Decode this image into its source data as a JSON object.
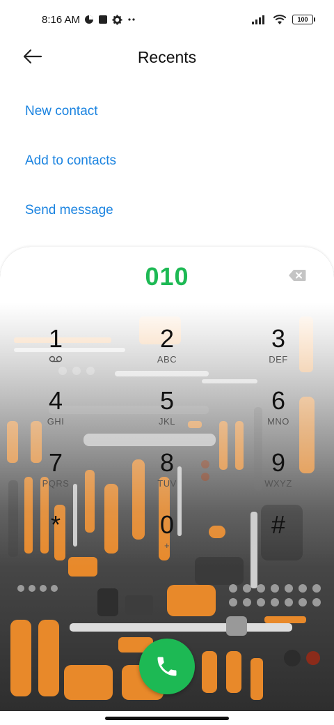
{
  "status_bar": {
    "time": "8:16 AM",
    "battery": "100",
    "icons": [
      "data-saver-icon",
      "square-icon",
      "gear-icon",
      "more-dots-icon",
      "signal-icon",
      "wifi-icon",
      "battery-icon"
    ]
  },
  "header": {
    "title": "Recents",
    "back_icon": "back-arrow-icon"
  },
  "actions": [
    {
      "label": "New contact"
    },
    {
      "label": "Add to contacts"
    },
    {
      "label": "Send message"
    }
  ],
  "dialer": {
    "number": "010",
    "backspace_icon": "backspace-icon",
    "keys": [
      {
        "digit": "1",
        "letters": "voicemail"
      },
      {
        "digit": "2",
        "letters": "ABC"
      },
      {
        "digit": "3",
        "letters": "DEF"
      },
      {
        "digit": "4",
        "letters": "GHI"
      },
      {
        "digit": "5",
        "letters": "JKL"
      },
      {
        "digit": "6",
        "letters": "MNO"
      },
      {
        "digit": "7",
        "letters": "PQRS"
      },
      {
        "digit": "8",
        "letters": "TUV"
      },
      {
        "digit": "9",
        "letters": "WXYZ"
      },
      {
        "digit": "*",
        "letters": ""
      },
      {
        "digit": "0",
        "letters": "+"
      },
      {
        "digit": "#",
        "letters": ""
      }
    ],
    "call_icon": "phone-icon",
    "colors": {
      "accent_green": "#1db954",
      "link_blue": "#1a83e0",
      "tool_orange": "#e8892a"
    }
  }
}
